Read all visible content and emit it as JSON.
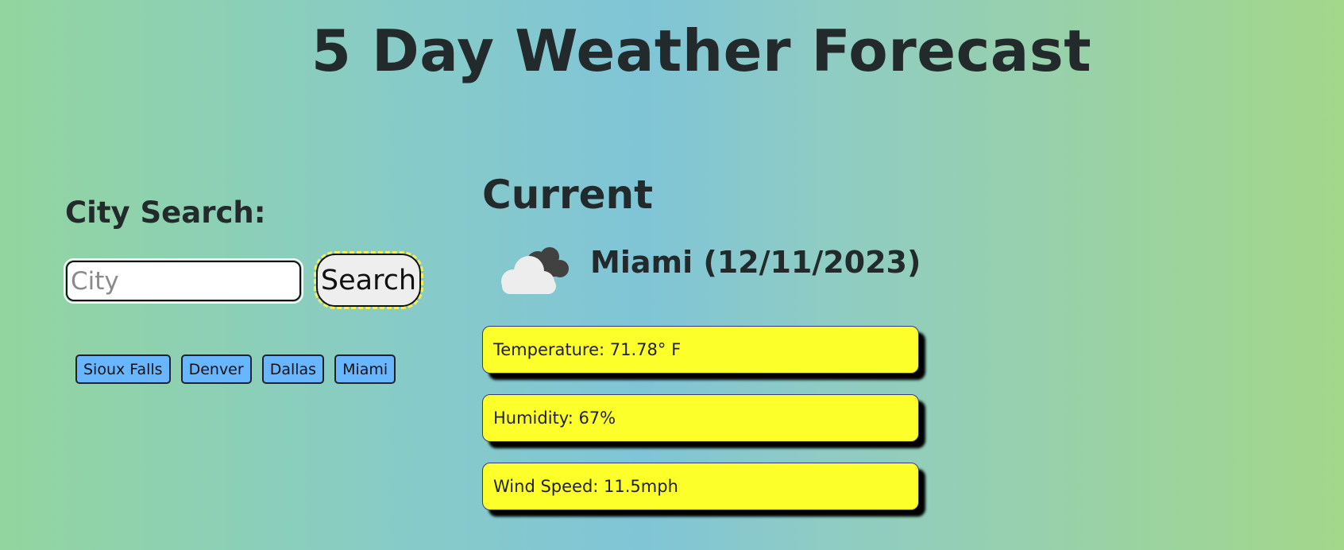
{
  "header": {
    "title": "5 Day Weather Forecast"
  },
  "search": {
    "label": "City Search:",
    "placeholder": "City",
    "value": "",
    "button_label": "Search"
  },
  "history": {
    "items": [
      {
        "label": "Sioux Falls"
      },
      {
        "label": "Denver"
      },
      {
        "label": "Dallas"
      },
      {
        "label": "Miami"
      }
    ]
  },
  "current": {
    "heading": "Current",
    "icon": "cloud-icon",
    "city_date": "Miami (12/11/2023)",
    "temperature": "Temperature: 71.78° F",
    "humidity": "Humidity: 67%",
    "wind": "Wind Speed: 11.5mph"
  },
  "colors": {
    "card_background": "#fdff2a",
    "history_button": "#68b6ff",
    "search_button": "#eeeeee"
  }
}
